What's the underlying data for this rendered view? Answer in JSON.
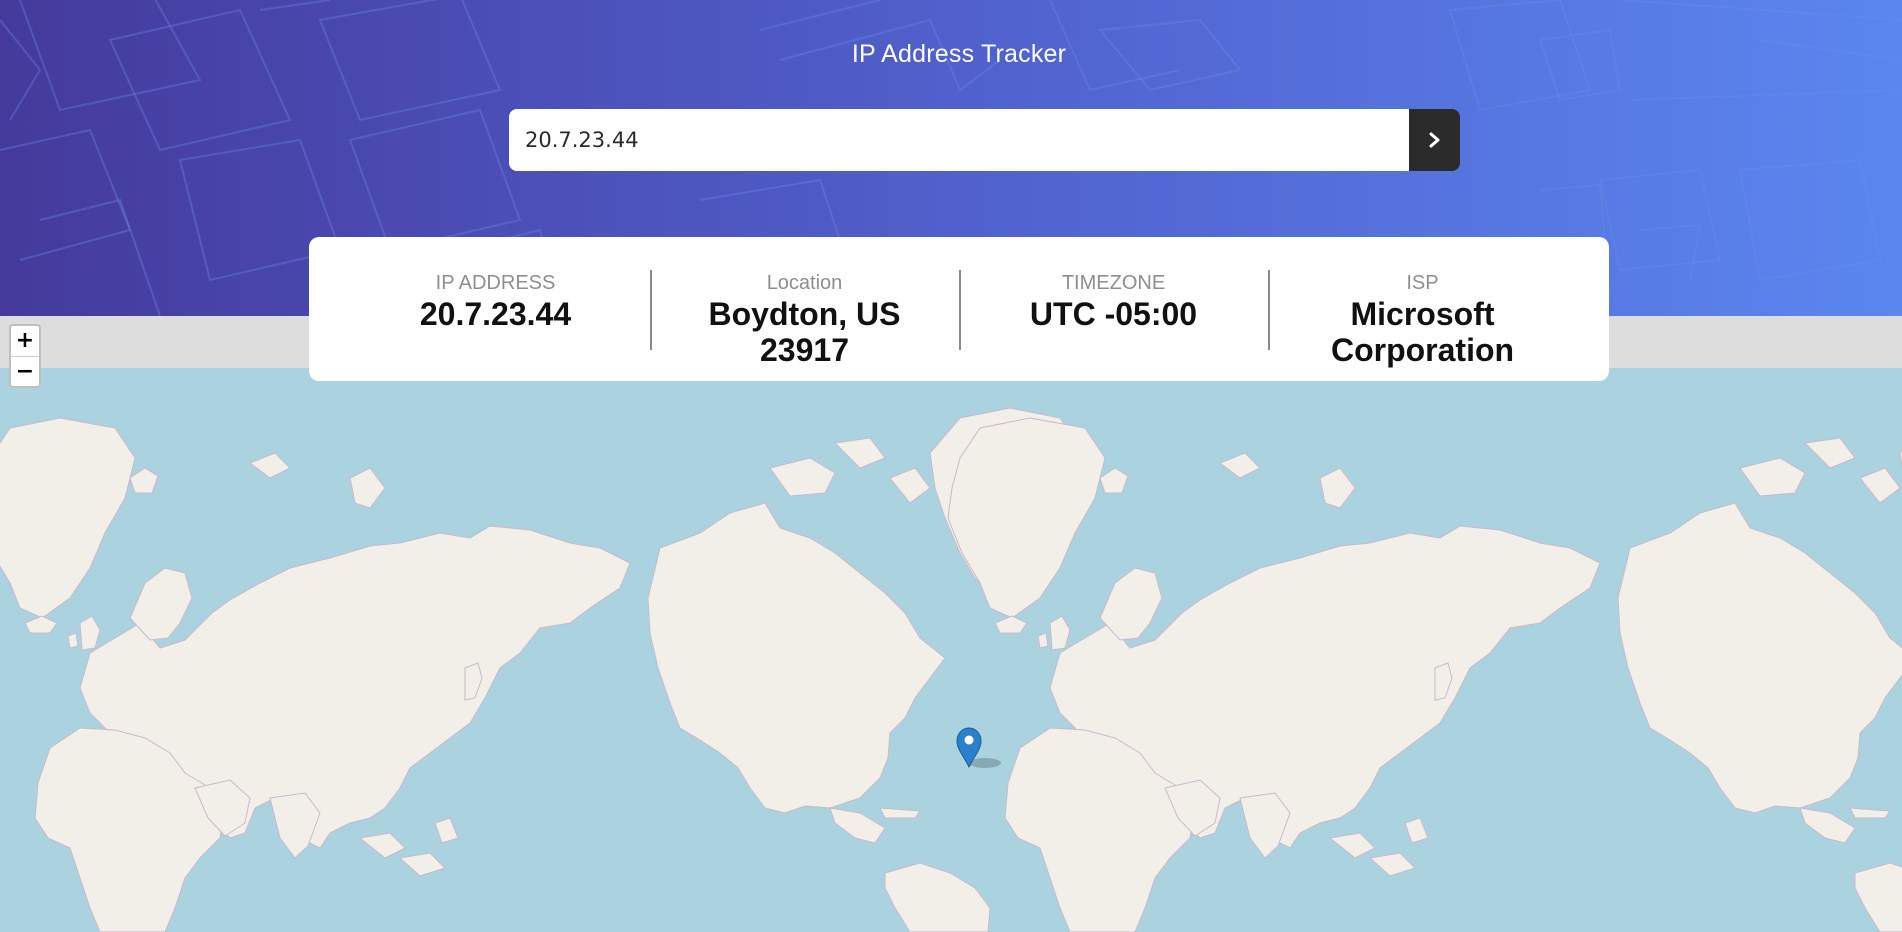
{
  "header": {
    "title": "IP Address Tracker"
  },
  "search": {
    "value": "20.7.23.44",
    "submit_icon": "chevron-right-icon"
  },
  "info": [
    {
      "label": "IP ADDRESS",
      "value": "20.7.23.44"
    },
    {
      "label": "Location",
      "value": "Boydton, US 23917"
    },
    {
      "label": "TIMEZONE",
      "value": "UTC -05:00"
    },
    {
      "label": "ISP",
      "value": "Microsoft Corporation"
    }
  ],
  "map": {
    "zoom_in": "+",
    "zoom_out": "−",
    "marker_icon": "location-pin-icon",
    "colors": {
      "water": "#aad3df",
      "land": "#f2efe9",
      "border": "#c8b9cc",
      "marker": "#2a81cb"
    }
  }
}
